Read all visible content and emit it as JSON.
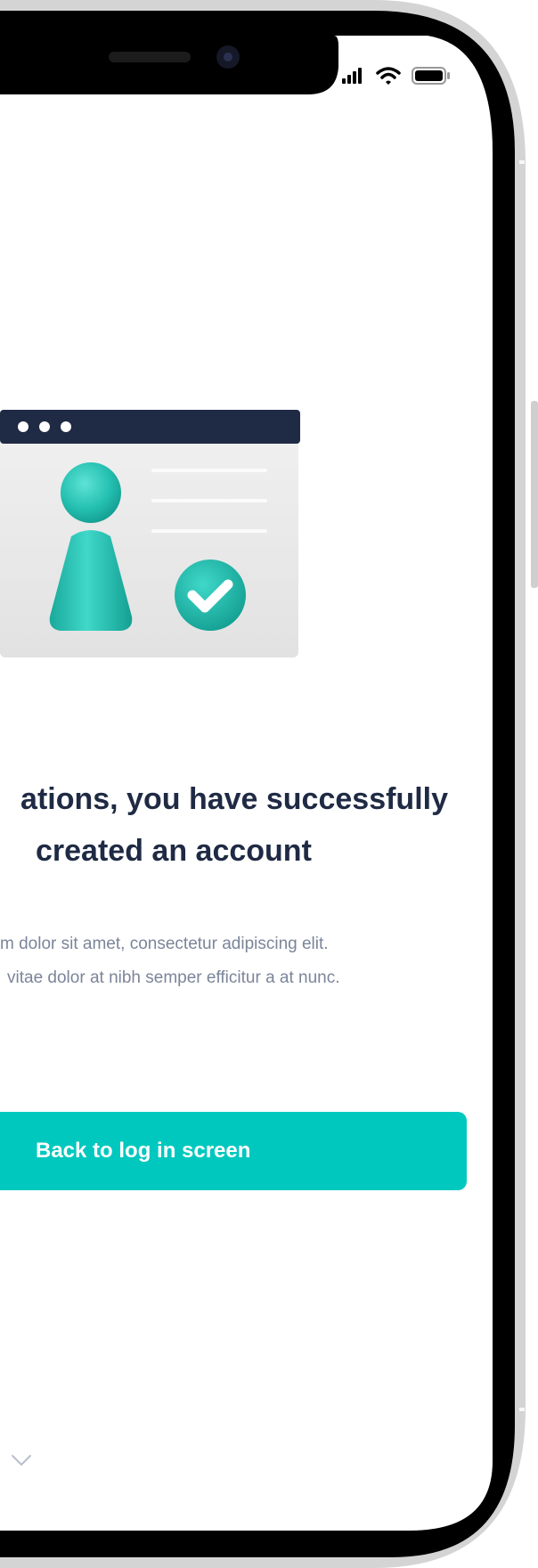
{
  "colors": {
    "accent": "#00c8be",
    "heading": "#1f2a44",
    "body": "#7b8599",
    "window_bar": "#1f2a44",
    "figure": "#25c0b1"
  },
  "status_bar": {
    "signal_icon": "cellular-signal-icon",
    "wifi_icon": "wifi-icon",
    "battery_icon": "battery-icon"
  },
  "illustration": {
    "name": "account-created-illustration",
    "icons": [
      "window-dots-icon",
      "user-figure-icon",
      "checkmark-badge-icon"
    ]
  },
  "headline": {
    "line1": "ations, you have successfully",
    "line2": "created an account"
  },
  "body": {
    "line1": "m dolor sit amet, consectetur adipiscing elit.",
    "line2": "vitae dolor at nibh semper efficitur a at nunc."
  },
  "cta": {
    "label": "Back to log in screen"
  },
  "footer": {
    "icon": "chevron-down-icon"
  }
}
